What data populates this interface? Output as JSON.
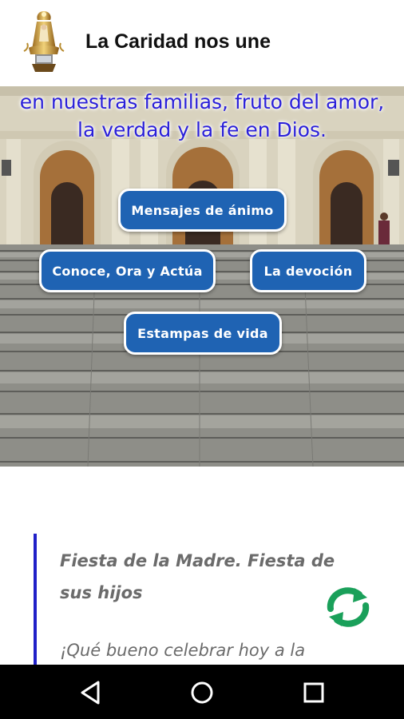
{
  "header": {
    "title": "La Caridad nos une",
    "logo_icon": "virgin-statue-icon"
  },
  "hero": {
    "text_line1": "en nuestras familias, fruto del amor,",
    "text_line2": "la verdad y la fe en Dios.",
    "text_color": "#2a1fd9",
    "buttons": [
      {
        "label": "Mensajes de ánimo"
      },
      {
        "label": "Conoce, Ora y Actúa"
      },
      {
        "label": "La devoción"
      },
      {
        "label": "Estampas de vida"
      }
    ],
    "button_color": "#1f63b3"
  },
  "article": {
    "title": "Fiesta de la Madre. Fiesta de sus hijos",
    "excerpt": "¡Qué bueno celebrar hoy a la",
    "accent_color": "#2020c8",
    "refresh_icon": "refresh-icon",
    "refresh_color": "#1aa05a"
  },
  "navbar": {
    "back_icon": "back-triangle-icon",
    "home_icon": "home-circle-icon",
    "recent_icon": "recent-square-icon"
  }
}
